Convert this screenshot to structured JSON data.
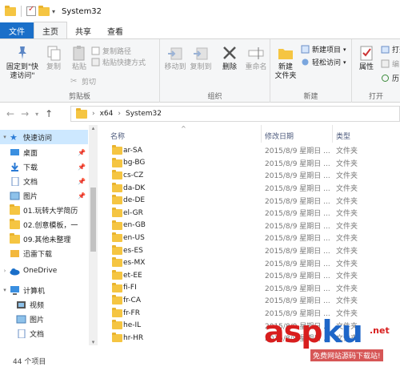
{
  "window": {
    "title": "System32"
  },
  "tabs": [
    "文件",
    "主页",
    "共享",
    "查看"
  ],
  "ribbon": {
    "clipboard": {
      "pin_label": "固定到\"快速访问\"",
      "copy_label": "复制",
      "paste_label": "粘贴",
      "copy_path": "复制路径",
      "paste_shortcut": "粘贴快捷方式",
      "cut": "剪切",
      "group": "剪贴板"
    },
    "organize": {
      "move_to": "移动到",
      "copy_to": "复制到",
      "delete": "删除",
      "rename": "重命名",
      "group": "组织"
    },
    "new": {
      "new_folder": "新建\n文件夹",
      "new_item": "新建项目",
      "easy_access": "轻松访问",
      "group": "新建"
    },
    "open": {
      "properties": "属性",
      "open": "打开",
      "edit": "编",
      "history": "历",
      "group": "打开"
    }
  },
  "address": {
    "crumbs": [
      "x64",
      "System32"
    ]
  },
  "sidebar": {
    "items": [
      {
        "label": "快速访问",
        "icon": "star-icon",
        "selected": true
      },
      {
        "label": "桌面",
        "icon": "desktop-icon",
        "pinned": true
      },
      {
        "label": "下载",
        "icon": "download-icon",
        "pinned": true
      },
      {
        "label": "文档",
        "icon": "document-icon",
        "pinned": true
      },
      {
        "label": "图片",
        "icon": "picture-icon",
        "pinned": true
      },
      {
        "label": "01.玩转大学简历",
        "icon": "folder-icon"
      },
      {
        "label": "02.创意模板，一",
        "icon": "folder-icon"
      },
      {
        "label": "09.其他未整理",
        "icon": "folder-icon"
      },
      {
        "label": "迅雷下载",
        "icon": "folder-icon"
      },
      {
        "label": "OneDrive",
        "icon": "cloud-icon"
      },
      {
        "label": "计算机",
        "icon": "computer-icon"
      },
      {
        "label": "视频",
        "icon": "video-icon"
      },
      {
        "label": "图片",
        "icon": "picture-icon"
      },
      {
        "label": "文档",
        "icon": "document-icon"
      }
    ]
  },
  "columns": {
    "name": "名称",
    "date": "修改日期",
    "type": "类型"
  },
  "files": [
    {
      "name": "ar-SA",
      "date": "2015/8/9 星期日 ...",
      "type": "文件夹"
    },
    {
      "name": "bg-BG",
      "date": "2015/8/9 星期日 ...",
      "type": "文件夹"
    },
    {
      "name": "cs-CZ",
      "date": "2015/8/9 星期日 ...",
      "type": "文件夹"
    },
    {
      "name": "da-DK",
      "date": "2015/8/9 星期日 ...",
      "type": "文件夹"
    },
    {
      "name": "de-DE",
      "date": "2015/8/9 星期日 ...",
      "type": "文件夹"
    },
    {
      "name": "el-GR",
      "date": "2015/8/9 星期日 ...",
      "type": "文件夹"
    },
    {
      "name": "en-GB",
      "date": "2015/8/9 星期日 ...",
      "type": "文件夹"
    },
    {
      "name": "en-US",
      "date": "2015/8/9 星期日 ...",
      "type": "文件夹"
    },
    {
      "name": "es-ES",
      "date": "2015/8/9 星期日 ...",
      "type": "文件夹"
    },
    {
      "name": "es-MX",
      "date": "2015/8/9 星期日 ...",
      "type": "文件夹"
    },
    {
      "name": "et-EE",
      "date": "2015/8/9 星期日 ...",
      "type": "文件夹"
    },
    {
      "name": "fi-FI",
      "date": "2015/8/9 星期日 ...",
      "type": "文件夹"
    },
    {
      "name": "fr-CA",
      "date": "2015/8/9 星期日 ...",
      "type": "文件夹"
    },
    {
      "name": "fr-FR",
      "date": "2015/8/9 星期日 ...",
      "type": "文件夹"
    },
    {
      "name": "he-IL",
      "date": "2015/8/9 星期日 ...",
      "type": "文件夹"
    },
    {
      "name": "hr-HR",
      "date": "2015/8/9 星期日 ...",
      "type": "文件夹"
    }
  ],
  "status": {
    "count": "44 个项目"
  },
  "watermark": {
    "brand_a": "asp",
    "brand_b": "ku",
    "tld": ".net",
    "sub": "免费网站源码下载站!"
  },
  "colors": {
    "accent": "#1a6fc9",
    "selected": "#cde8ff",
    "folder": "#f5c542",
    "watermark_red": "#d81e1e",
    "watermark_blue": "#1e66c8"
  }
}
